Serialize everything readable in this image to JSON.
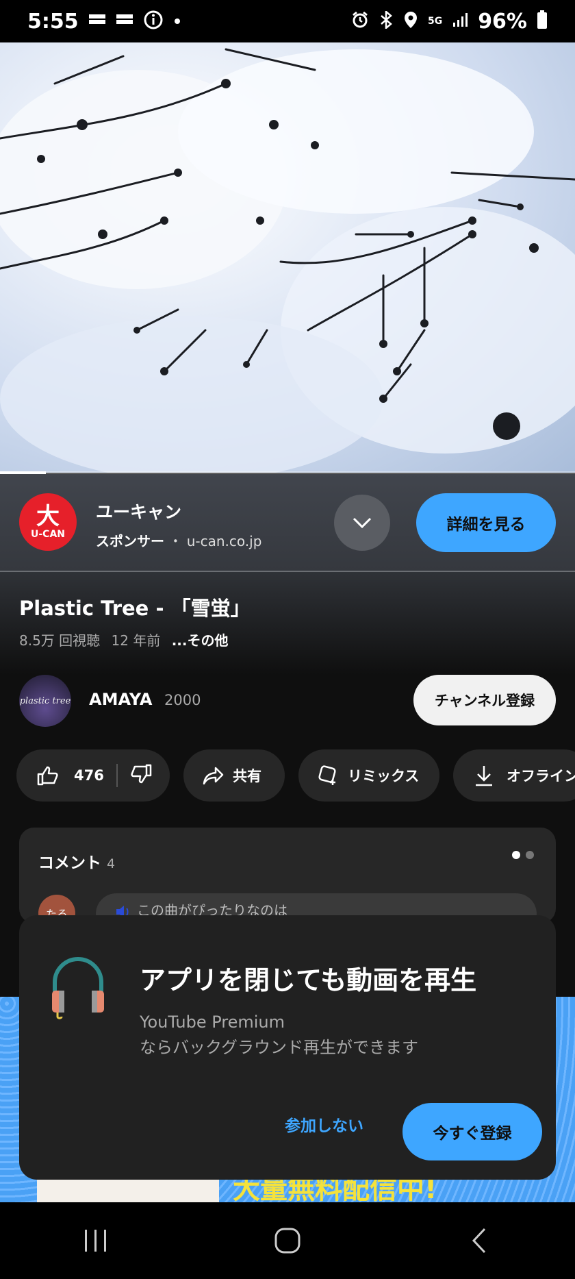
{
  "status_bar": {
    "time": "5:55",
    "battery": "96%",
    "network": "5G"
  },
  "video": {
    "progress_fraction": 0.08
  },
  "ad": {
    "logo_glyph": "大",
    "logo_text": "U-CAN",
    "advertiser": "ユーキャン",
    "sponsor_label": "スポンサー",
    "separator": "・",
    "domain": "u-can.co.jp",
    "cta_label": "詳細を見る"
  },
  "video_info": {
    "title": "Plastic Tree - 「雪蛍」",
    "views": "8.5万 回視聴",
    "age": "12 年前",
    "more_label": "...その他"
  },
  "channel": {
    "avatar_text": "plastic tree",
    "name": "AMAYA",
    "subscribers": "2000",
    "subscribe_label": "チャンネル登録"
  },
  "actions": {
    "like_count": "476",
    "share_label": "共有",
    "remix_label": "リミックス",
    "offline_label": "オフライン"
  },
  "comments": {
    "title": "コメント",
    "count": "4",
    "avatar_text": "たる",
    "preview": "この曲がぴったりなのは"
  },
  "banner": {
    "text": "大量無料配信中!"
  },
  "dialog": {
    "title": "アプリを閉じても動画を再生",
    "body_line1": "YouTube Premium",
    "body_line2": "ならバックグラウンド再生ができます",
    "skip_label": "参加しない",
    "join_label": "今すぐ登録"
  },
  "colors": {
    "accent": "#3ea6ff",
    "brand_red": "#e6202a",
    "background": "#0f0f0f",
    "card": "#272727"
  }
}
